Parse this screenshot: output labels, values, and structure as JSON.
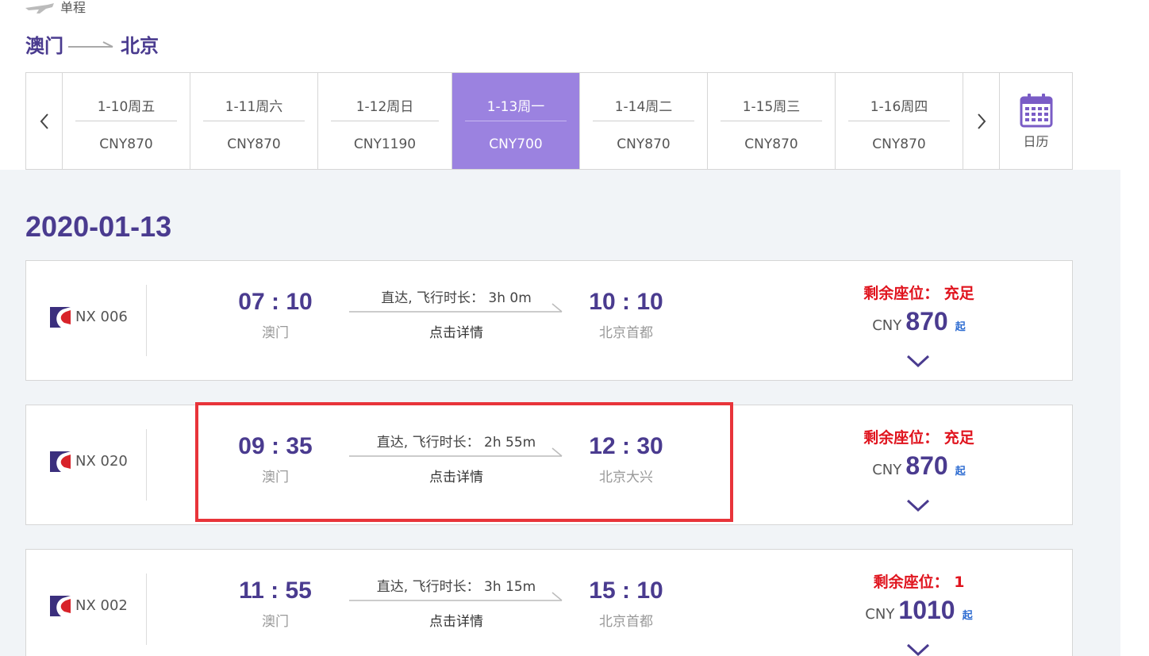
{
  "header": {
    "trip_type": "单程",
    "origin": "澳门",
    "destination": "北京"
  },
  "date_strip": {
    "days": [
      {
        "date": "1-10周五",
        "price": "CNY870",
        "active": false
      },
      {
        "date": "1-11周六",
        "price": "CNY870",
        "active": false
      },
      {
        "date": "1-12周日",
        "price": "CNY1190",
        "active": false
      },
      {
        "date": "1-13周一",
        "price": "CNY700",
        "active": true
      },
      {
        "date": "1-14周二",
        "price": "CNY870",
        "active": false
      },
      {
        "date": "1-15周三",
        "price": "CNY870",
        "active": false
      },
      {
        "date": "1-16周四",
        "price": "CNY870",
        "active": false
      }
    ],
    "calendar_label": "日历"
  },
  "results": {
    "date_heading": "2020-01-13",
    "flights": [
      {
        "number": "NX 006",
        "dep_time": "07 : 10",
        "dep_city": "澳门",
        "info": "直达, 飞行时长： 3h 0m",
        "detail": "点击详情",
        "arr_time": "10 : 10",
        "arr_city": "北京首都",
        "seats": "剩余座位： 充足",
        "currency": "CNY",
        "price": "870",
        "from": "起"
      },
      {
        "number": "NX 020",
        "dep_time": "09 : 35",
        "dep_city": "澳门",
        "info": "直达, 飞行时长： 2h 55m",
        "detail": "点击详情",
        "arr_time": "12 : 30",
        "arr_city": "北京大兴",
        "seats": "剩余座位： 充足",
        "currency": "CNY",
        "price": "870",
        "from": "起"
      },
      {
        "number": "NX 002",
        "dep_time": "11 : 55",
        "dep_city": "澳门",
        "info": "直达, 飞行时长： 3h 15m",
        "detail": "点击详情",
        "arr_time": "15 : 10",
        "arr_city": "北京首都",
        "seats": "剩余座位： 1",
        "currency": "CNY",
        "price": "1010",
        "from": "起"
      }
    ]
  },
  "icons": {
    "plane": "plane-icon",
    "route_arrow": "arrow-right-icon",
    "prev": "chevron-left-icon",
    "next": "chevron-right-icon",
    "calendar": "calendar-icon",
    "airline_logo": "airline-logo-icon",
    "expand": "chevron-down-icon"
  },
  "colors": {
    "brand_purple": "#4a3b8f",
    "active_day": "#9b82e0",
    "seats_red": "#e0141e",
    "highlight_red": "#e8343a"
  }
}
